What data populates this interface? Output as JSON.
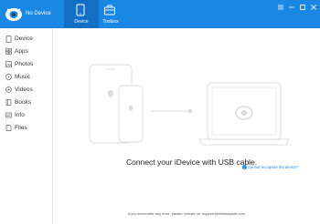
{
  "app": {
    "title": "No Device"
  },
  "tabs": [
    {
      "label": "Device",
      "icon": "phone-icon",
      "active": true
    },
    {
      "label": "Toolbox",
      "icon": "toolbox-icon",
      "active": false
    }
  ],
  "sidebar": {
    "items": [
      {
        "label": "Device",
        "icon": "device-icon"
      },
      {
        "label": "Apps",
        "icon": "apps-icon"
      },
      {
        "label": "Photos",
        "icon": "photos-icon"
      },
      {
        "label": "Music",
        "icon": "music-icon"
      },
      {
        "label": "Videos",
        "icon": "videos-icon"
      },
      {
        "label": "Books",
        "icon": "books-icon"
      },
      {
        "label": "Info",
        "icon": "info-icon"
      },
      {
        "label": "Files",
        "icon": "files-icon"
      }
    ]
  },
  "main": {
    "connect_message": "Connect your iDevice with USB cable.",
    "help_link": "Cannot recognize the device?",
    "help_icon_glyph": "?",
    "footer": "If you encounter any error, please contact us: support@thinkskysoft.com"
  },
  "colors": {
    "accent": "#1b87e5",
    "accent_dark": "#126fc4",
    "illustration": "#dcdcdc"
  }
}
